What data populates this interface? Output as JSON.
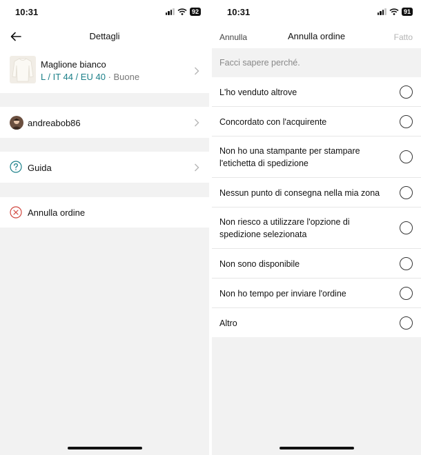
{
  "left_screen": {
    "status": {
      "time": "10:31",
      "battery": "92"
    },
    "header": {
      "title": "Dettagli"
    },
    "item": {
      "name": "Maglione bianco",
      "size": "L / IT 44 / EU 40",
      "separator": " · ",
      "condition": "Buone"
    },
    "seller": {
      "username": "andreabob86"
    },
    "help": {
      "label": "Guida"
    },
    "cancel": {
      "label": "Annulla ordine"
    }
  },
  "right_screen": {
    "status": {
      "time": "10:31",
      "battery": "91"
    },
    "header": {
      "cancel_label": "Annulla",
      "title": "Annulla ordine",
      "done_label": "Fatto"
    },
    "prompt": "Facci sapere perché.",
    "reasons": [
      "L'ho venduto altrove",
      "Concordato con l'acquirente",
      "Non ho una stampante per stampare l'etichetta di spedizione",
      "Nessun punto di consegna nella mia zona",
      "Non riesco a utilizzare l'opzione di spedizione selezionata",
      "Non sono disponibile",
      "Non ho tempo per inviare l'ordine",
      "Altro"
    ]
  },
  "colors": {
    "accent_teal": "#1a7f88",
    "cancel_red": "#d0453d",
    "help_teal": "#1a7f88",
    "background": "#f2f2f2"
  },
  "icons": [
    "back-arrow-icon",
    "chevron-right-icon",
    "question-icon",
    "close-circle-icon",
    "signal-icon",
    "wifi-icon",
    "battery-icon"
  ]
}
